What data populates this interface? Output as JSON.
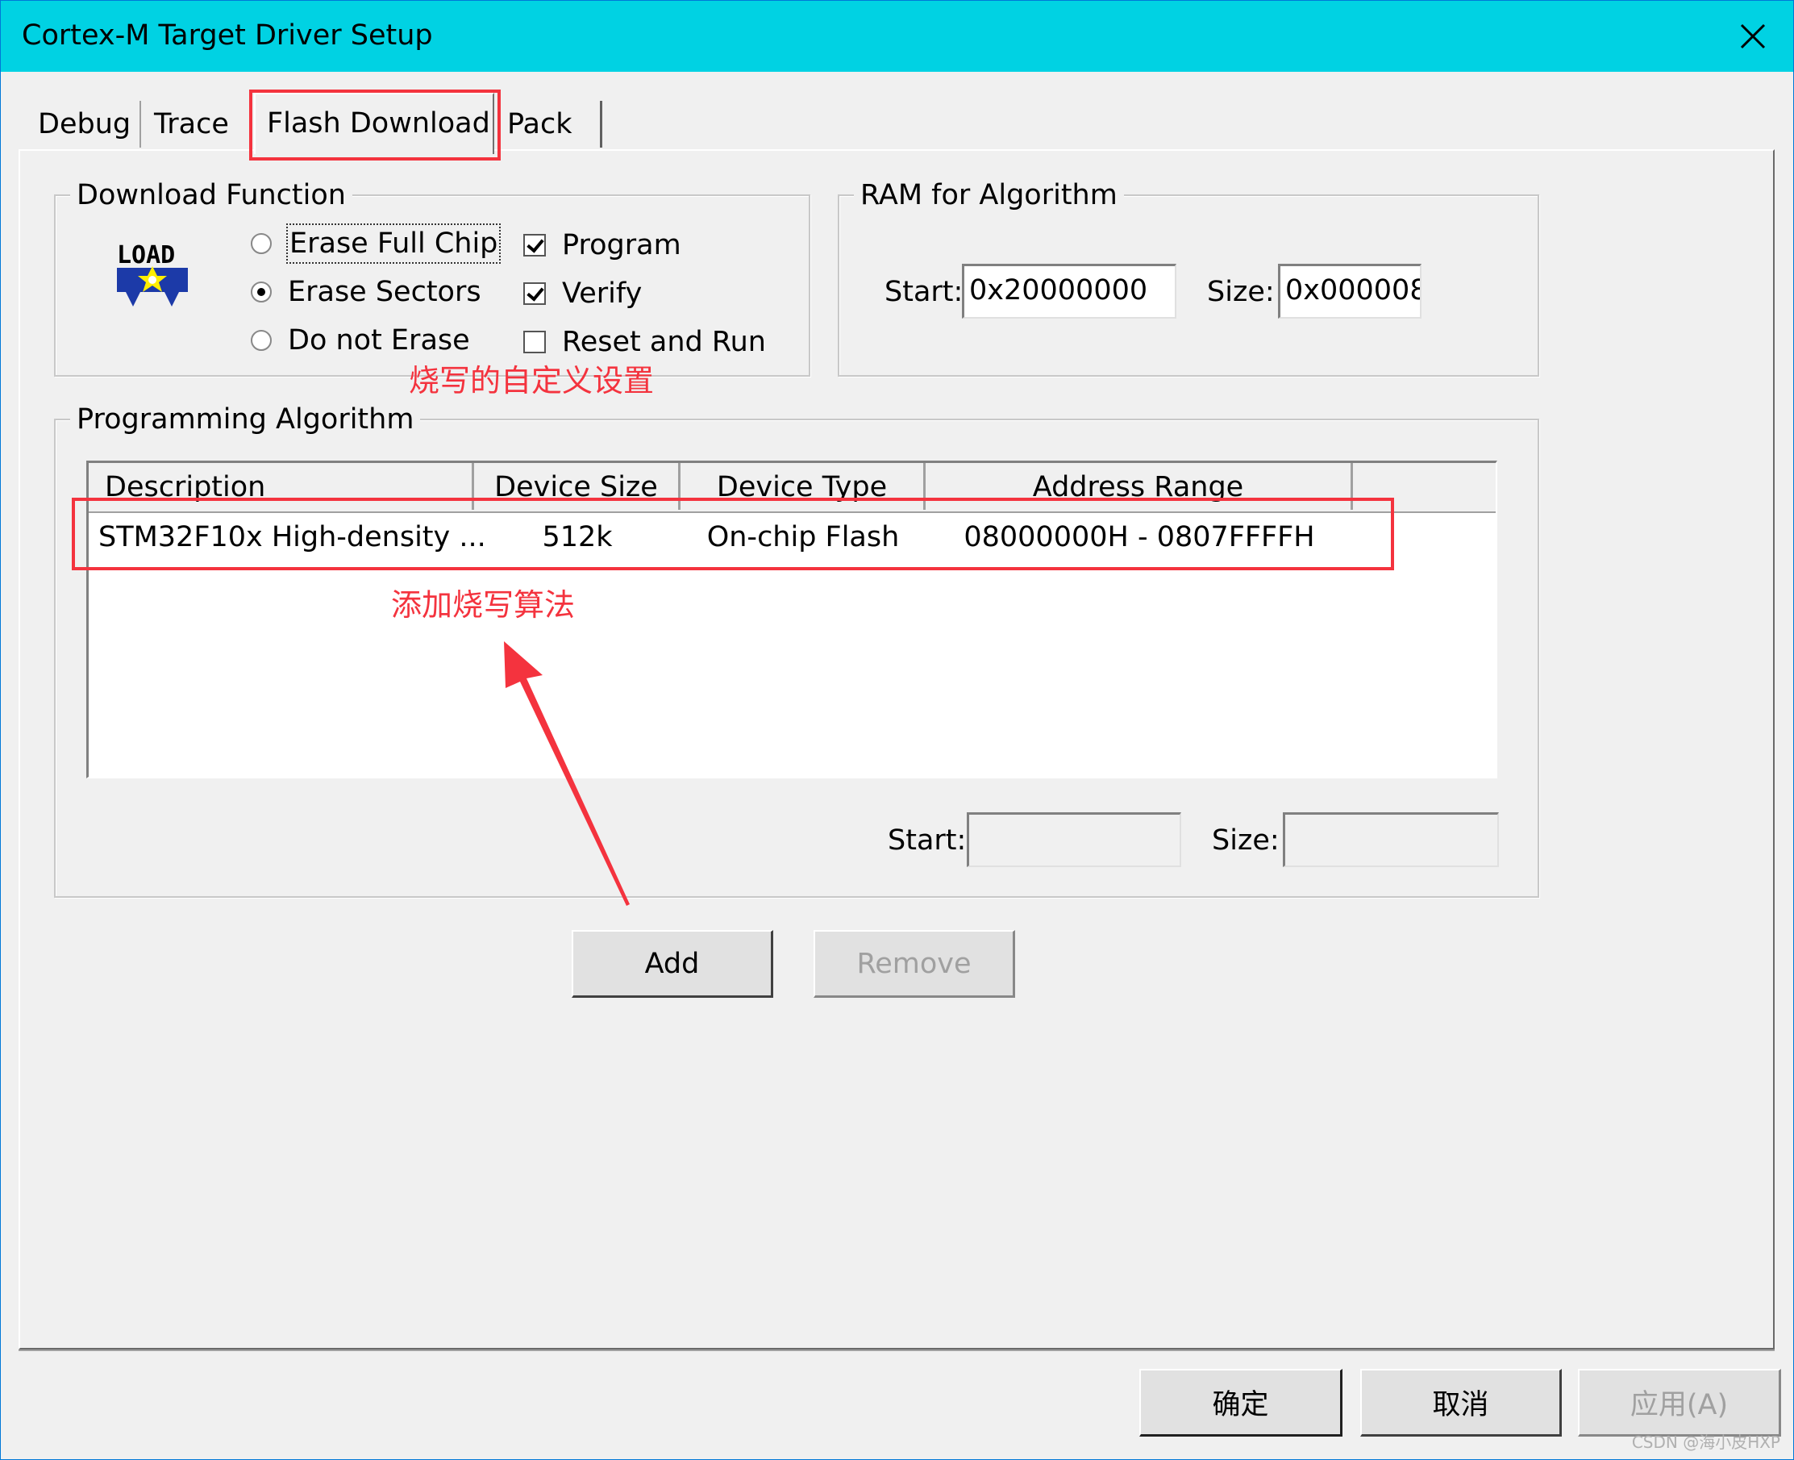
{
  "window": {
    "title": "Cortex-M Target Driver Setup"
  },
  "tabs": [
    {
      "label": "Debug"
    },
    {
      "label": "Trace"
    },
    {
      "label": "Flash Download",
      "selected": true
    },
    {
      "label": "Pack"
    }
  ],
  "download_function": {
    "legend": "Download Function",
    "icon": "load-icon",
    "erase_full_chip": "Erase Full Chip",
    "erase_sectors": "Erase Sectors",
    "do_not_erase": "Do not Erase",
    "selected_erase": "Erase Sectors",
    "program": "Program",
    "verify": "Verify",
    "reset_and_run": "Reset and Run",
    "program_checked": true,
    "verify_checked": true,
    "reset_and_run_checked": false
  },
  "ram_for_algorithm": {
    "legend": "RAM for Algorithm",
    "start_label": "Start:",
    "start_value": "0x20000000",
    "size_label": "Size:",
    "size_value": "0x000008"
  },
  "programming_algorithm": {
    "legend": "Programming Algorithm",
    "columns": [
      "Description",
      "Device Size",
      "Device Type",
      "Address Range"
    ],
    "rows": [
      {
        "description": "STM32F10x High-density ...",
        "device_size": "512k",
        "device_type": "On-chip Flash",
        "address_range": "08000000H - 0807FFFFH"
      }
    ],
    "start_label": "Start:",
    "start_value": "",
    "size_label": "Size:",
    "size_value": ""
  },
  "buttons": {
    "add": "Add",
    "remove": "Remove",
    "ok": "确定",
    "cancel": "取消",
    "apply": "应用(A)"
  },
  "annotations": {
    "settings_note": "烧写的自定义设置",
    "add_algorithm_note": "添加烧写算法",
    "color": "#f4333e"
  },
  "watermark": "CSDN @海小皮HXP"
}
